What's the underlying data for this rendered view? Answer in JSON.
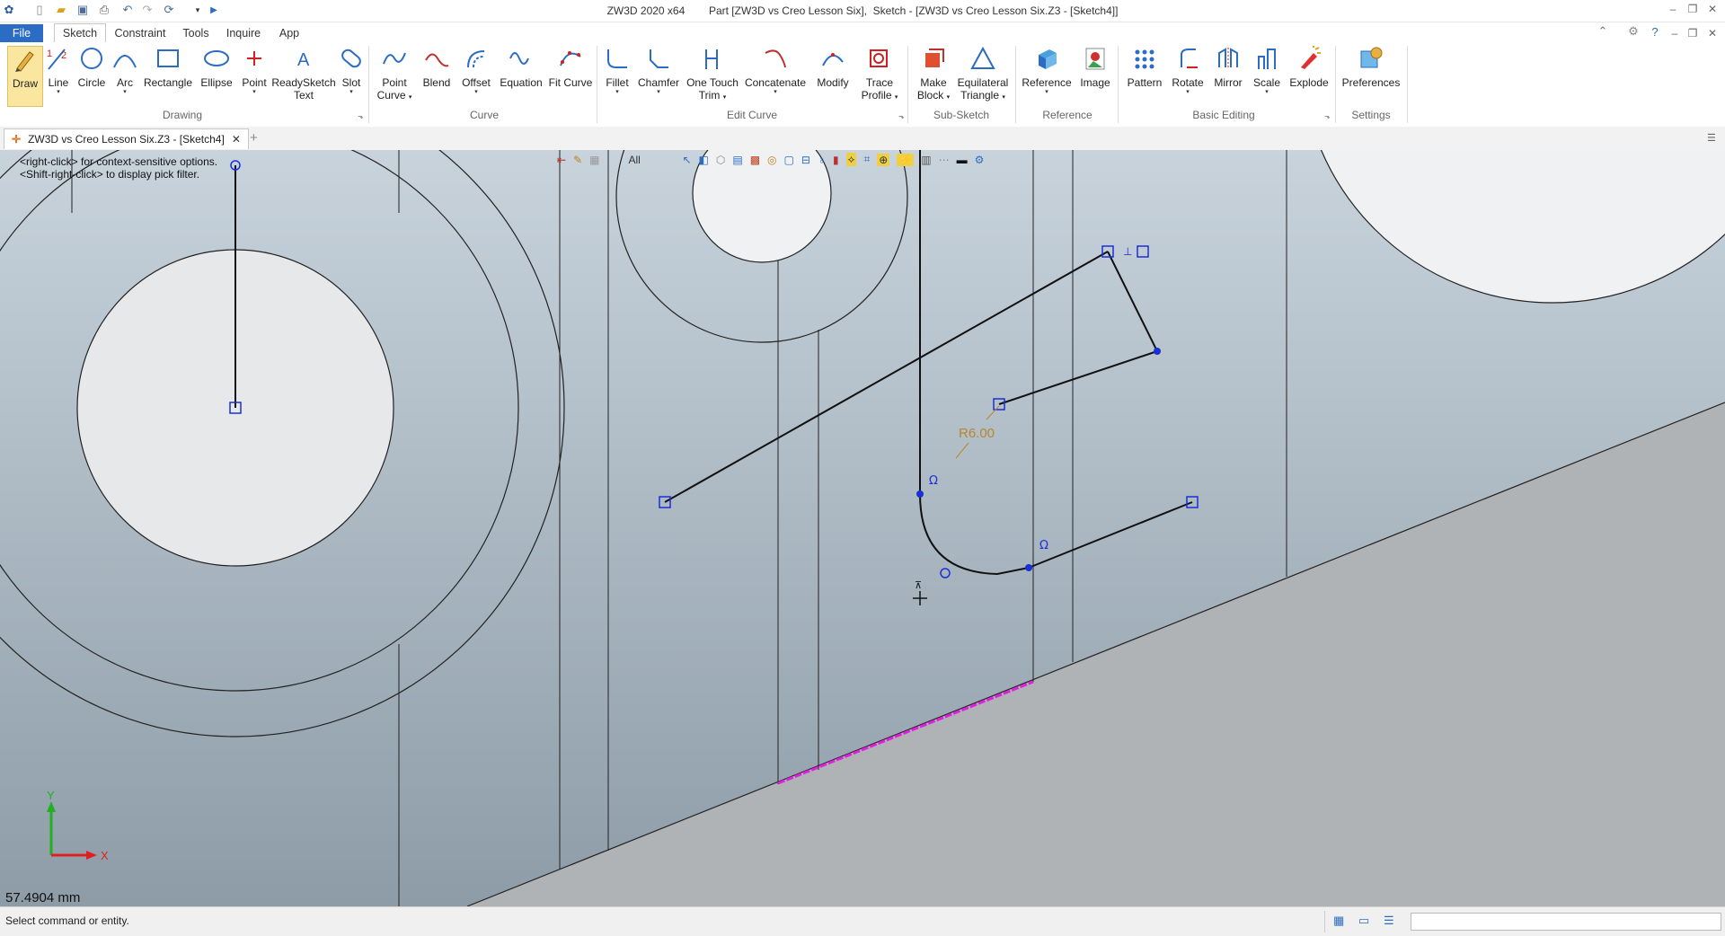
{
  "titlebar": {
    "title": "ZW3D 2020 x64        Part [ZW3D vs Creo Lesson Six],  Sketch - [ZW3D vs Creo Lesson Six.Z3 - [Sketch4]]"
  },
  "menu": {
    "file": "File",
    "sketch": "Sketch",
    "constraint": "Constraint",
    "tools": "Tools",
    "inquire": "Inquire",
    "app": "App"
  },
  "ribbon": {
    "draw": {
      "label": "Draw"
    },
    "line": {
      "label": "Line"
    },
    "circle": {
      "label": "Circle"
    },
    "arc": {
      "label": "Arc"
    },
    "rectangle": {
      "label": "Rectangle"
    },
    "ellipse": {
      "label": "Ellipse"
    },
    "point": {
      "label": "Point"
    },
    "readysketch": {
      "label1": "ReadySketch",
      "label2": "Text"
    },
    "slot": {
      "label": "Slot"
    },
    "point_curve": {
      "label1": "Point",
      "label2": "Curve"
    },
    "blend": {
      "label": "Blend"
    },
    "offset": {
      "label": "Offset"
    },
    "equation": {
      "label": "Equation"
    },
    "fit_curve": {
      "label": "Fit Curve"
    },
    "fillet": {
      "label": "Fillet"
    },
    "chamfer": {
      "label": "Chamfer"
    },
    "one_touch": {
      "label1": "One Touch",
      "label2": "Trim"
    },
    "concatenate": {
      "label": "Concatenate"
    },
    "modify": {
      "label": "Modify"
    },
    "trace": {
      "label1": "Trace",
      "label2": "Profile"
    },
    "make_block": {
      "label1": "Make",
      "label2": "Block"
    },
    "equilateral": {
      "label1": "Equilateral",
      "label2": "Triangle"
    },
    "reference": {
      "label": "Reference"
    },
    "image": {
      "label": "Image"
    },
    "pattern": {
      "label": "Pattern"
    },
    "rotate": {
      "label": "Rotate"
    },
    "mirror": {
      "label": "Mirror"
    },
    "scale": {
      "label": "Scale"
    },
    "explode": {
      "label": "Explode"
    },
    "preferences": {
      "label": "Preferences"
    },
    "groups": {
      "drawing": "Drawing",
      "curve": "Curve",
      "edit_curve": "Edit Curve",
      "sub_sketch": "Sub-Sketch",
      "reference": "Reference",
      "basic_editing": "Basic Editing",
      "settings": "Settings"
    }
  },
  "document_tab": {
    "label": "ZW3D vs Creo Lesson Six.Z3 - [Sketch4]"
  },
  "viewport": {
    "hint_1": "<right-click> for context-sensitive options.",
    "hint_2": "<Shift-right-click> to display pick filter.",
    "filter_label": "All",
    "dimension_label": "R6.00",
    "axis_x": "X",
    "axis_y": "Y",
    "scale_readout": "57.4904 mm"
  },
  "status": {
    "message": "Select command or entity."
  },
  "colors": {
    "accent": "#2b6cc4",
    "highlight": "#e020e0",
    "dimension": "#b8862b",
    "handle": "#1a2fd6"
  }
}
